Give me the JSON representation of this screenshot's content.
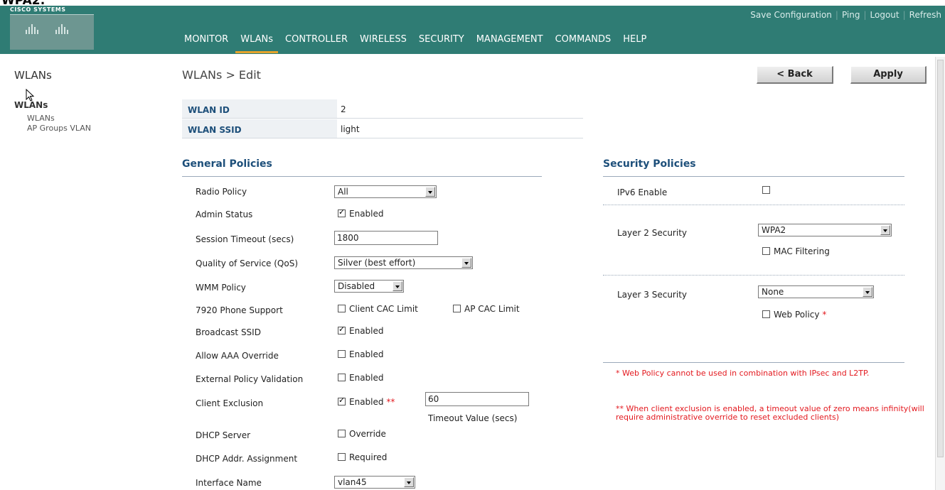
{
  "page_heading_fragment": "WPA2:",
  "header": {
    "brand": "CISCO SYSTEMS",
    "top_links": [
      "Save Configuration",
      "Ping",
      "Logout",
      "Refresh"
    ],
    "nav": [
      "MONITOR",
      "WLANs",
      "CONTROLLER",
      "WIRELESS",
      "SECURITY",
      "MANAGEMENT",
      "COMMANDS",
      "HELP"
    ],
    "active_nav": "WLANs"
  },
  "sidebar": {
    "title": "WLANs",
    "section": "WLANs",
    "items": [
      "WLANs",
      "AP Groups VLAN"
    ]
  },
  "main": {
    "page_title": "WLANs > Edit",
    "back_button": "< Back",
    "apply_button": "Apply",
    "wlan_id_label": "WLAN ID",
    "wlan_id_value": "2",
    "wlan_ssid_label": "WLAN SSID",
    "wlan_ssid_value": "light"
  },
  "general": {
    "title": "General Policies",
    "radio_policy": {
      "label": "Radio Policy",
      "value": "All"
    },
    "admin_status": {
      "label": "Admin Status",
      "checkbox_label": "Enabled",
      "checked": true
    },
    "session_timeout": {
      "label": "Session Timeout (secs)",
      "value": "1800"
    },
    "qos": {
      "label": "Quality of Service (QoS)",
      "value": "Silver (best effort)"
    },
    "wmm_policy": {
      "label": "WMM Policy",
      "value": "Disabled"
    },
    "phone_support": {
      "label": "7920 Phone Support",
      "client_cac": "Client CAC Limit",
      "ap_cac": "AP CAC Limit"
    },
    "broadcast_ssid": {
      "label": "Broadcast SSID",
      "checkbox_label": "Enabled",
      "checked": true
    },
    "aaa_override": {
      "label": "Allow AAA Override",
      "checkbox_label": "Enabled",
      "checked": false
    },
    "external_policy": {
      "label": "External Policy Validation",
      "checkbox_label": "Enabled",
      "checked": false
    },
    "client_exclusion": {
      "label": "Client Exclusion",
      "checkbox_label": "Enabled",
      "checked": true,
      "stars": "**",
      "timeout_value": "60",
      "timeout_label": "Timeout Value (secs)"
    },
    "dhcp_server": {
      "label": "DHCP Server",
      "checkbox_label": "Override",
      "checked": false
    },
    "dhcp_addr": {
      "label": "DHCP Addr. Assignment",
      "checkbox_label": "Required",
      "checked": false
    },
    "interface_name": {
      "label": "Interface Name",
      "value": "vlan45"
    }
  },
  "security": {
    "title": "Security Policies",
    "ipv6": {
      "label": "IPv6 Enable",
      "checked": false
    },
    "layer2": {
      "label": "Layer 2 Security",
      "value": "WPA2",
      "mac_filtering": "MAC Filtering"
    },
    "layer3": {
      "label": "Layer 3 Security",
      "value": "None",
      "web_policy": "Web Policy",
      "web_policy_star": "*"
    },
    "note1": "* Web Policy cannot be used in combination with IPsec and L2TP.",
    "note2": "** When client exclusion is enabled, a timeout value of zero means infinity(will require administrative override to reset excluded clients)"
  },
  "colors": {
    "header_bg": "#2f7c74",
    "nav_active": "#e5a32b",
    "label_blue": "#1d4f7a",
    "note_red": "#e3191f"
  }
}
